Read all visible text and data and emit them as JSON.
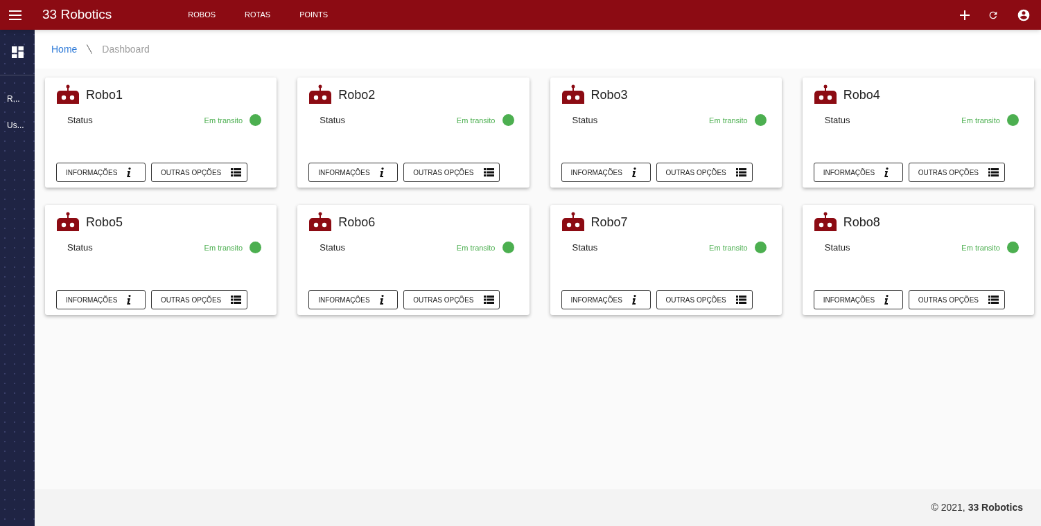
{
  "app_bar": {
    "title": "33 Robotics",
    "nav": [
      {
        "label": "ROBOS"
      },
      {
        "label": "ROTAS"
      },
      {
        "label": "POINTS"
      }
    ]
  },
  "sidebar": {
    "items": [
      {
        "label": "R..."
      },
      {
        "label": "Us..."
      }
    ]
  },
  "breadcrumb": [
    {
      "label": "Home",
      "kind": "link"
    },
    {
      "label": "Dashboard",
      "kind": "current"
    }
  ],
  "robots": [
    {
      "name": "Robo1",
      "status_label": "Status",
      "status": "Em transito",
      "color": "#4caf50",
      "buttons": [
        "INFORMAÇÕES",
        "OUTRAS OPÇÕES"
      ]
    },
    {
      "name": "Robo2",
      "status_label": "Status",
      "status": "Em transito",
      "color": "#4caf50",
      "buttons": [
        "INFORMAÇÕES",
        "OUTRAS OPÇÕES"
      ]
    },
    {
      "name": "Robo3",
      "status_label": "Status",
      "status": "Em transito",
      "color": "#4caf50",
      "buttons": [
        "INFORMAÇÕES",
        "OUTRAS OPÇÕES"
      ]
    },
    {
      "name": "Robo4",
      "status_label": "Status",
      "status": "Em transito",
      "color": "#4caf50",
      "buttons": [
        "INFORMAÇÕES",
        "OUTRAS OPÇÕES"
      ]
    },
    {
      "name": "Robo5",
      "status_label": "Status",
      "status": "Em transito",
      "color": "#4caf50",
      "buttons": [
        "INFORMAÇÕES",
        "OUTRAS OPÇÕES"
      ]
    },
    {
      "name": "Robo6",
      "status_label": "Status",
      "status": "Em transito",
      "color": "#4caf50",
      "buttons": [
        "INFORMAÇÕES",
        "OUTRAS OPÇÕES"
      ]
    },
    {
      "name": "Robo7",
      "status_label": "Status",
      "status": "Em transito",
      "color": "#4caf50",
      "buttons": [
        "INFORMAÇÕES",
        "OUTRAS OPÇÕES"
      ]
    },
    {
      "name": "Robo8",
      "status_label": "Status",
      "status": "Em transito",
      "color": "#4caf50",
      "buttons": [
        "INFORMAÇÕES",
        "OUTRAS OPÇÕES"
      ]
    }
  ],
  "footer": {
    "text": "© 2021, **33 Robotics**"
  }
}
